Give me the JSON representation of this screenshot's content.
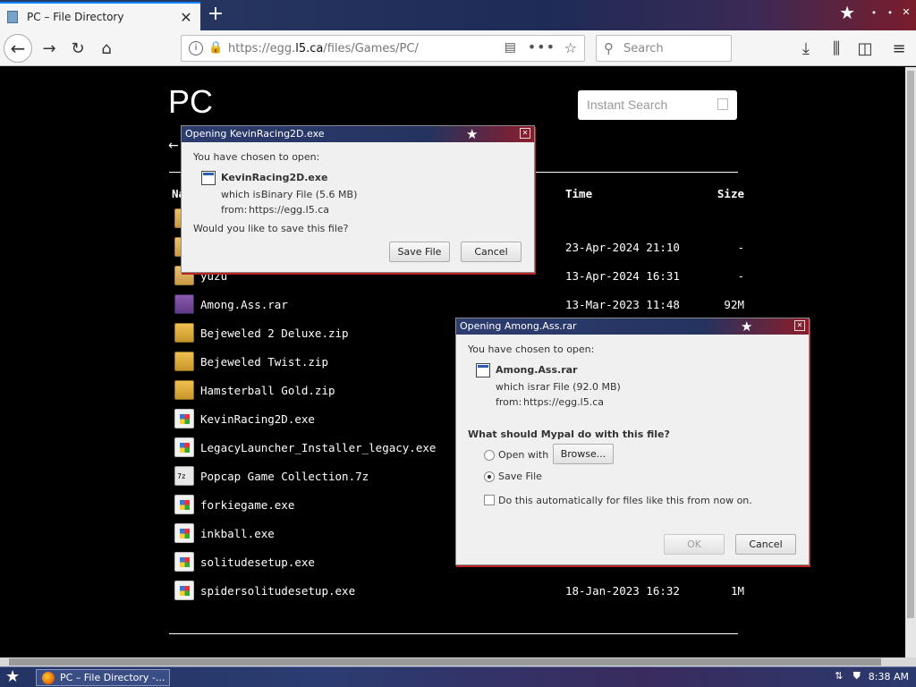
{
  "browser": {
    "tab_title": "PC – File Directory",
    "url_prefix": "https://egg.",
    "url_domain": "l5.ca",
    "url_path": "/files/Games/PC/",
    "search_placeholder": "Search",
    "icons": {
      "back": "arrow-left-icon",
      "forward": "arrow-right-icon",
      "reload": "reload-icon",
      "home": "home-icon",
      "downloads": "download-icon",
      "library": "library-icon",
      "sidebar": "sidebar-icon",
      "menu": "hamburger-menu-icon"
    }
  },
  "page": {
    "title": "PC",
    "instant_search_placeholder": "Instant Search",
    "back_arrow": "←",
    "headers": {
      "name": "Name",
      "time": "Time",
      "size": "Size"
    },
    "files": [
      {
        "name": "",
        "time": "",
        "size": "",
        "type": "folder"
      },
      {
        "name": "",
        "time": "23-Apr-2024 21:10",
        "size": "-",
        "type": "folder"
      },
      {
        "name": "yuzu",
        "time": "13-Apr-2024 16:31",
        "size": "-",
        "type": "folder"
      },
      {
        "name": "Among.Ass.rar",
        "time": "13-Mar-2023 11:48",
        "size": "92M",
        "type": "rar"
      },
      {
        "name": "Bejeweled 2 Deluxe.zip",
        "time": "",
        "size": "",
        "type": "zip"
      },
      {
        "name": "Bejeweled Twist.zip",
        "time": "",
        "size": "",
        "type": "zip"
      },
      {
        "name": "Hamsterball Gold.zip",
        "time": "",
        "size": "",
        "type": "zip"
      },
      {
        "name": "KevinRacing2D.exe",
        "time": "",
        "size": "",
        "type": "exe"
      },
      {
        "name": "LegacyLauncher_Installer_legacy.exe",
        "time": "",
        "size": "",
        "type": "exe"
      },
      {
        "name": "Popcap Game Collection.7z",
        "time": "",
        "size": "",
        "type": "7z"
      },
      {
        "name": "forkiegame.exe",
        "time": "",
        "size": "",
        "type": "exe"
      },
      {
        "name": "inkball.exe",
        "time": "",
        "size": "",
        "type": "exe"
      },
      {
        "name": "solitudesetup.exe",
        "time": "",
        "size": "",
        "type": "exe"
      },
      {
        "name": "spidersolitudesetup.exe",
        "time": "18-Jan-2023 16:32",
        "size": "1M",
        "type": "exe"
      }
    ]
  },
  "dialog1": {
    "title": "Opening KevinRacing2D.exe",
    "intro": "You have chosen to open:",
    "filename": "KevinRacing2D.exe",
    "which_is_label": "which is:",
    "which_is_value": "Binary File (5.6 MB)",
    "from_label": "from:",
    "from_value": "https://egg.l5.ca",
    "question": "Would you like to save this file?",
    "save_button": "Save File",
    "cancel_button": "Cancel"
  },
  "dialog2": {
    "title": "Opening Among.Ass.rar",
    "intro": "You have chosen to open:",
    "filename": "Among.Ass.rar",
    "which_is_label": "which is:",
    "which_is_value": "rar File (92.0 MB)",
    "from_label": "from:",
    "from_value": "https://egg.l5.ca",
    "question": "What should Mypal do with this file?",
    "open_with_label": "Open with",
    "browse_button": "Browse...",
    "save_file_label": "Save File",
    "auto_label": "Do this automatically for files like this from now on.",
    "ok_button": "OK",
    "cancel_button": "Cancel",
    "selected_option": "Save File"
  },
  "taskbar": {
    "task_label": "PC – File Directory -...",
    "clock": "8:38 AM"
  }
}
